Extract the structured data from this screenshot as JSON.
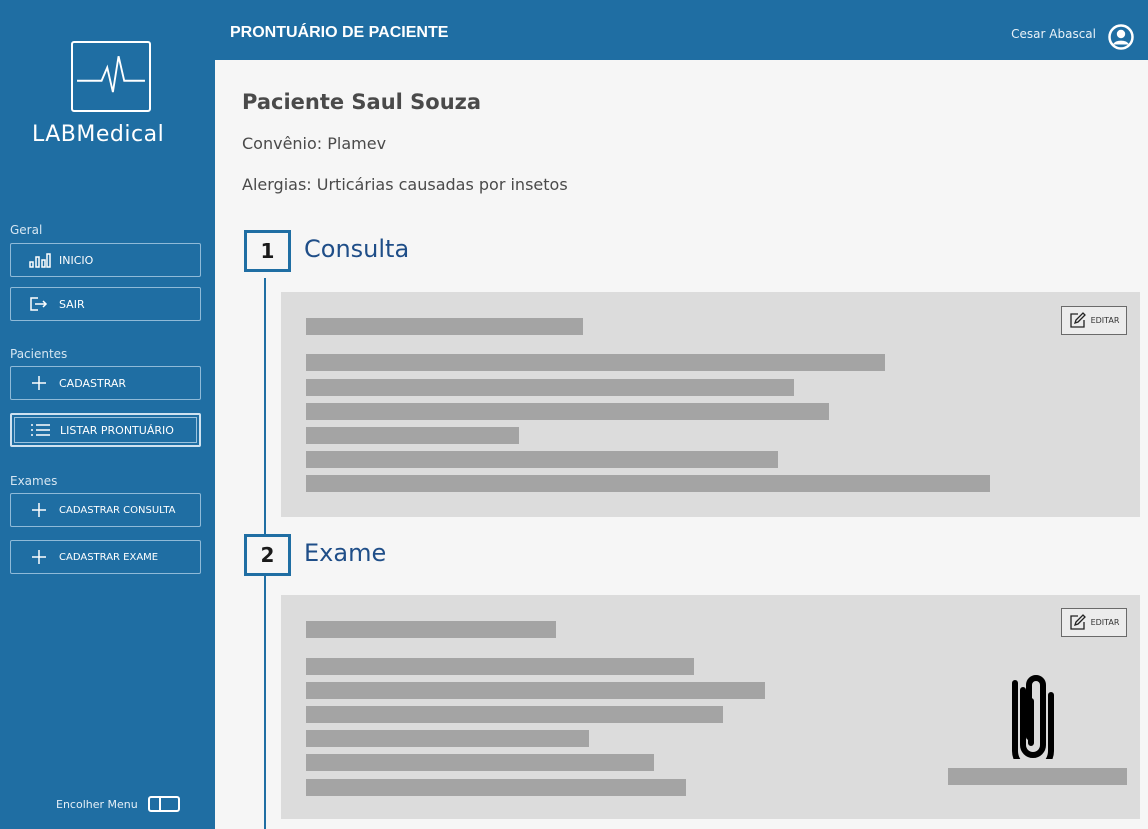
{
  "app": {
    "logo_text": "LABMedical",
    "page_title": "PRONTUÁRIO DE PACIENTE",
    "user_name": "Cesar Abascal",
    "colors": {
      "primary": "#1f6ea3",
      "heading": "#1f4e88",
      "card": "#dcdcdc",
      "placeholder": "#a4a4a4"
    }
  },
  "sidebar": {
    "groups": {
      "geral": "Geral",
      "pacientes": "Pacientes",
      "exames": "Exames"
    },
    "items": [
      {
        "label": "INICIO",
        "icon": "bar-chart-icon"
      },
      {
        "label": "SAIR",
        "icon": "logout-icon"
      },
      {
        "label": "CADASTRAR",
        "icon": "plus-icon"
      },
      {
        "label": "LISTAR PRONTUÁRIO",
        "icon": "list-icon",
        "active": true
      },
      {
        "label": "CADASTRAR CONSULTA",
        "icon": "plus-icon"
      },
      {
        "label": "CADASTRAR EXAME",
        "icon": "plus-icon"
      }
    ],
    "collapse_label": "Encolher Menu"
  },
  "patient": {
    "name": "Paciente Saul Souza",
    "insurance": "Convênio: Plamev",
    "allergies": "Alergias: Urticárias causadas por insetos"
  },
  "timeline": [
    {
      "number": "1",
      "title": "Consulta",
      "edit_label": "EDITAR"
    },
    {
      "number": "2",
      "title": "Exame",
      "edit_label": "EDITAR",
      "attachment_icon": "paperclip-icon"
    }
  ]
}
